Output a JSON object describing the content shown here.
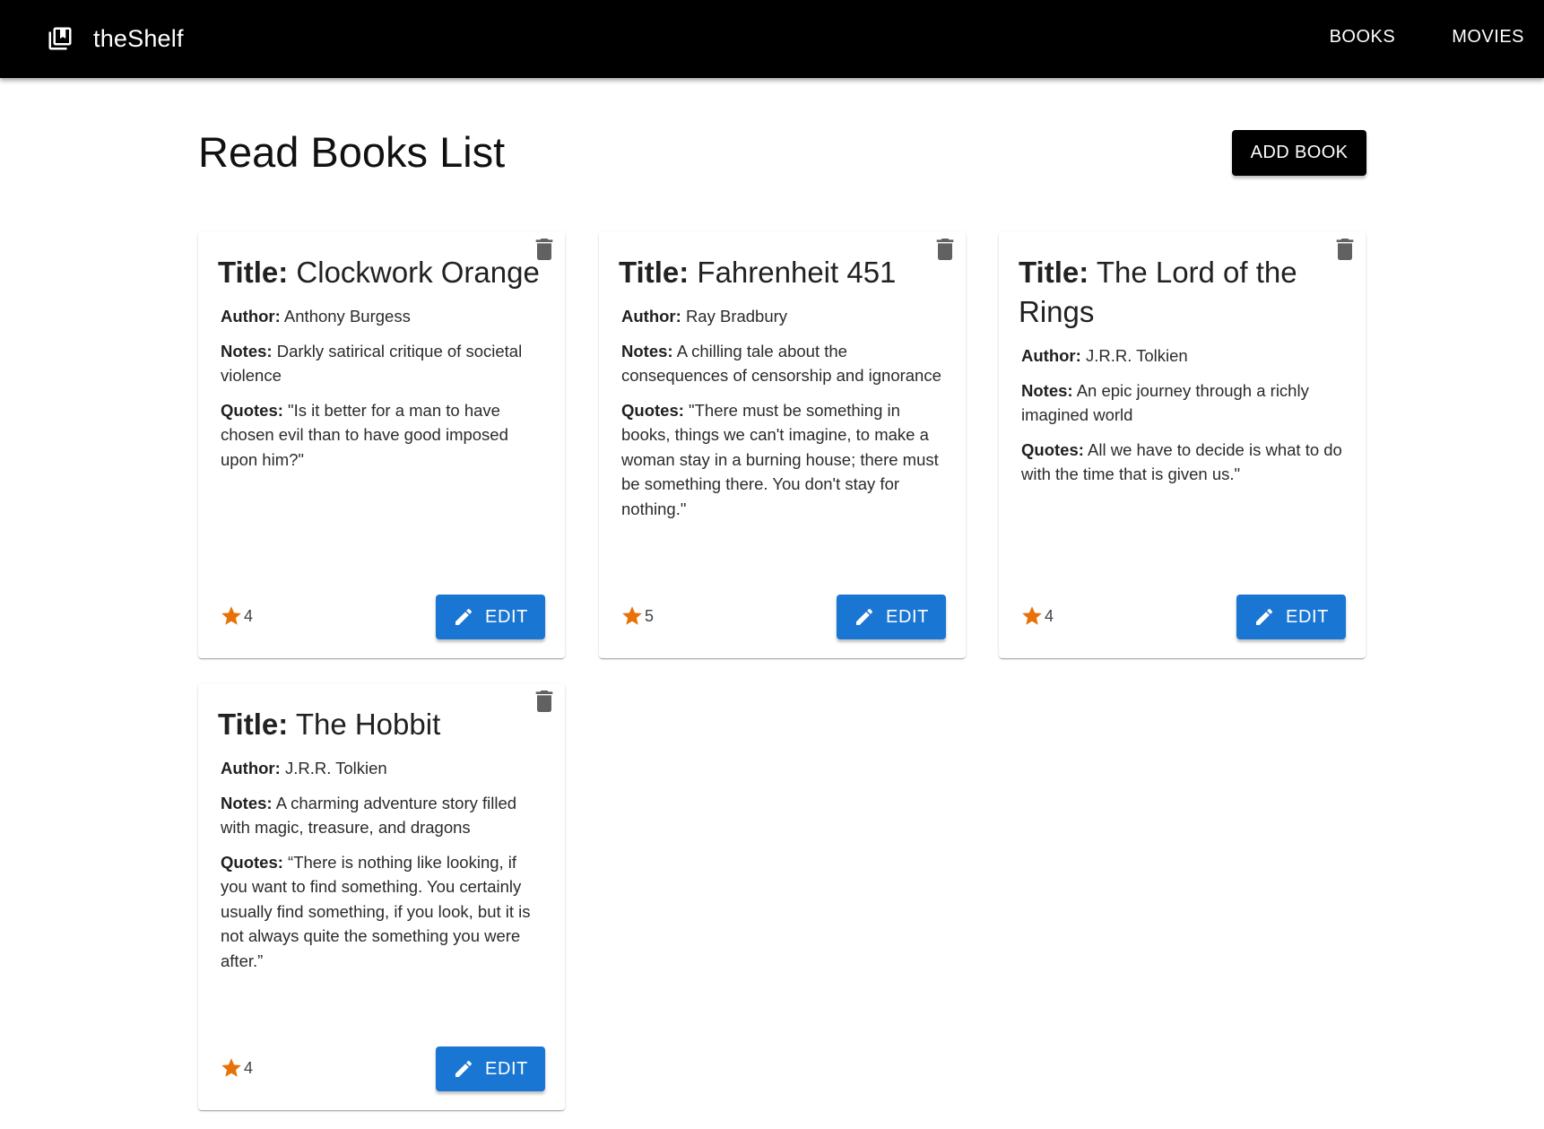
{
  "app": {
    "name": "theShelf",
    "nav": [
      "BOOKS",
      "MOVIES"
    ]
  },
  "page": {
    "title": "Read Books List",
    "add_button": "ADD BOOK"
  },
  "labels": {
    "title": "Title:",
    "author": "Author:",
    "notes": "Notes:",
    "quotes": "Quotes:",
    "edit": "EDIT"
  },
  "books": [
    {
      "title": "Clockwork Orange",
      "author": "Anthony Burgess",
      "notes": "Darkly satirical critique of societal violence",
      "quotes": "\"Is it better for a man to have chosen evil than to have good imposed upon him?\"",
      "rating": "4"
    },
    {
      "title": "Fahrenheit 451",
      "author": "Ray Bradbury",
      "notes": "A chilling tale about the consequences of censorship and ignorance",
      "quotes": "\"There must be something in books, things we can't imagine, to make a woman stay in a burning house; there must be something there. You don't stay for nothing.\"",
      "rating": "5"
    },
    {
      "title": "The Lord of the Rings",
      "author": "J.R.R. Tolkien",
      "notes": "An epic journey through a richly imagined world",
      "quotes": "All we have to decide is what to do with the time that is given us.\"",
      "rating": "4"
    },
    {
      "title": "The Hobbit",
      "author": "J.R.R. Tolkien",
      "notes": "A charming adventure story filled with magic, treasure, and dragons",
      "quotes": "“There is nothing like looking, if you want to find something. You certainly usually find something, if you look, but it is not always quite the something you were after.”",
      "rating": "4"
    }
  ],
  "icons": {
    "brand": "library-books-icon",
    "delete": "trash-icon",
    "rating": "star-icon",
    "edit": "pencil-icon"
  },
  "colors": {
    "appbar": "#000000",
    "primary": "#1976d2",
    "star": "#e8710a",
    "trash": "#616161"
  }
}
